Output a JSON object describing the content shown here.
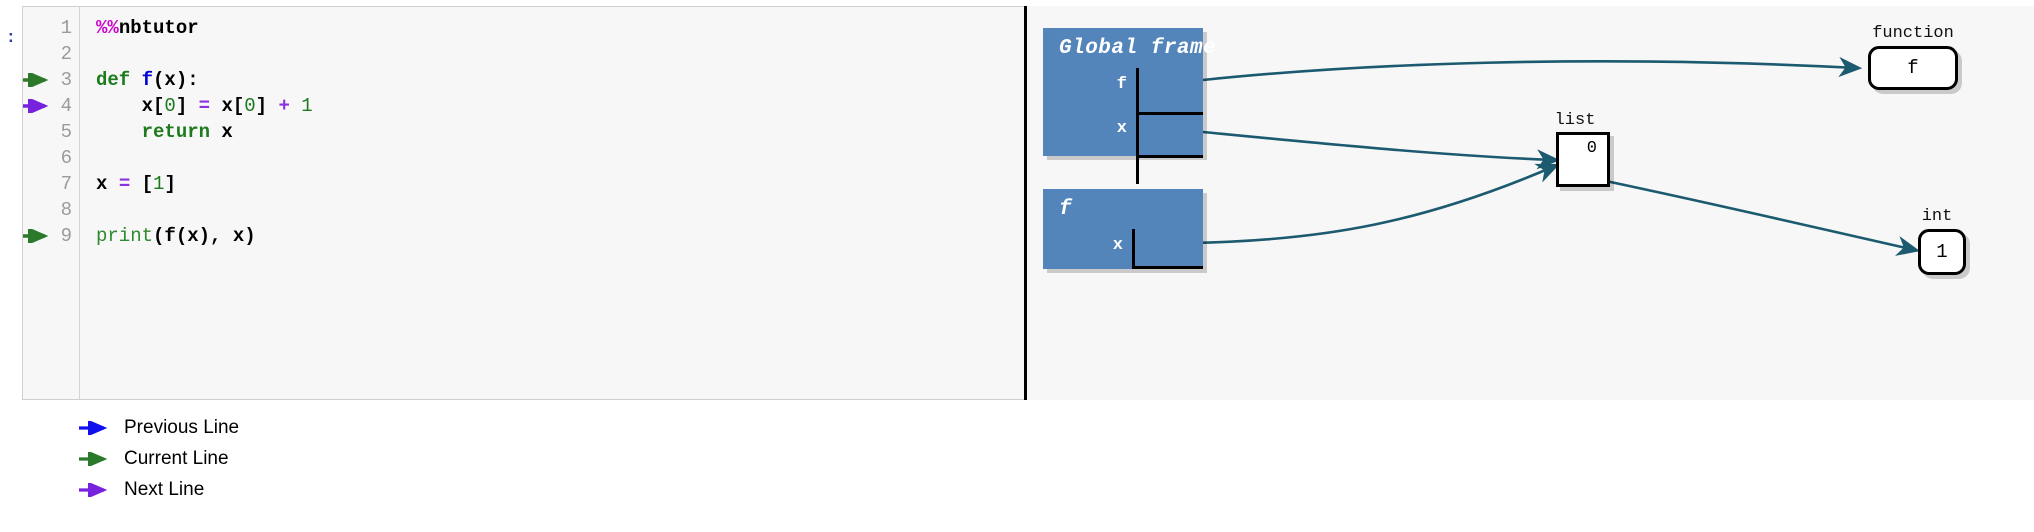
{
  "cell": {
    "prompt": ":",
    "lines": [
      {
        "number": "1",
        "marker": "none",
        "tokens": [
          {
            "t": "%%",
            "c": "magic"
          },
          {
            "t": "nbtutor",
            "c": "plain"
          }
        ]
      },
      {
        "number": "2",
        "marker": "none",
        "tokens": []
      },
      {
        "number": "3",
        "marker": "current",
        "tokens": [
          {
            "t": "def",
            "c": "kw"
          },
          {
            "t": " ",
            "c": "punc"
          },
          {
            "t": "f",
            "c": "fn"
          },
          {
            "t": "(x):",
            "c": "plain"
          }
        ]
      },
      {
        "number": "4",
        "marker": "next",
        "tokens": [
          {
            "t": "    x[",
            "c": "plain"
          },
          {
            "t": "0",
            "c": "num"
          },
          {
            "t": "] ",
            "c": "plain"
          },
          {
            "t": "=",
            "c": "op"
          },
          {
            "t": " x[",
            "c": "plain"
          },
          {
            "t": "0",
            "c": "num"
          },
          {
            "t": "] ",
            "c": "plain"
          },
          {
            "t": "+",
            "c": "op"
          },
          {
            "t": " ",
            "c": "plain"
          },
          {
            "t": "1",
            "c": "num"
          }
        ]
      },
      {
        "number": "5",
        "marker": "none",
        "tokens": [
          {
            "t": "    ",
            "c": "plain"
          },
          {
            "t": "return",
            "c": "kw"
          },
          {
            "t": " x",
            "c": "plain"
          }
        ]
      },
      {
        "number": "6",
        "marker": "none",
        "tokens": []
      },
      {
        "number": "7",
        "marker": "none",
        "tokens": [
          {
            "t": "x ",
            "c": "plain"
          },
          {
            "t": "=",
            "c": "op"
          },
          {
            "t": " [",
            "c": "plain"
          },
          {
            "t": "1",
            "c": "num"
          },
          {
            "t": "]",
            "c": "plain"
          }
        ]
      },
      {
        "number": "8",
        "marker": "none",
        "tokens": []
      },
      {
        "number": "9",
        "marker": "current",
        "tokens": [
          {
            "t": "print",
            "c": "builtin"
          },
          {
            "t": "(f(x), x)",
            "c": "plain"
          }
        ]
      }
    ]
  },
  "visualization": {
    "frames": [
      {
        "title": "Global frame",
        "variables": [
          {
            "name": "f"
          },
          {
            "name": "x"
          }
        ]
      },
      {
        "title": "f",
        "variables": [
          {
            "name": "x"
          }
        ]
      }
    ],
    "objects": [
      {
        "type_label": "function",
        "value": "f",
        "shape": "rounded"
      },
      {
        "type_label": "list",
        "value": "0",
        "shape": "square"
      },
      {
        "type_label": "int",
        "value": "1",
        "shape": "rounded"
      }
    ]
  },
  "legend": {
    "items": [
      {
        "label": "Previous Line",
        "color": "#1010ee"
      },
      {
        "label": "Current Line",
        "color": "#2b7a2b"
      },
      {
        "label": "Next Line",
        "color": "#7722dd"
      }
    ]
  },
  "colors": {
    "frame_fill": "#5384ba",
    "pointer_arrow": "#1c5a70",
    "cell_background": "#f7f7f7",
    "previous_line": "#1010ee",
    "current_line": "#2b7a2b",
    "next_line": "#7722dd"
  }
}
